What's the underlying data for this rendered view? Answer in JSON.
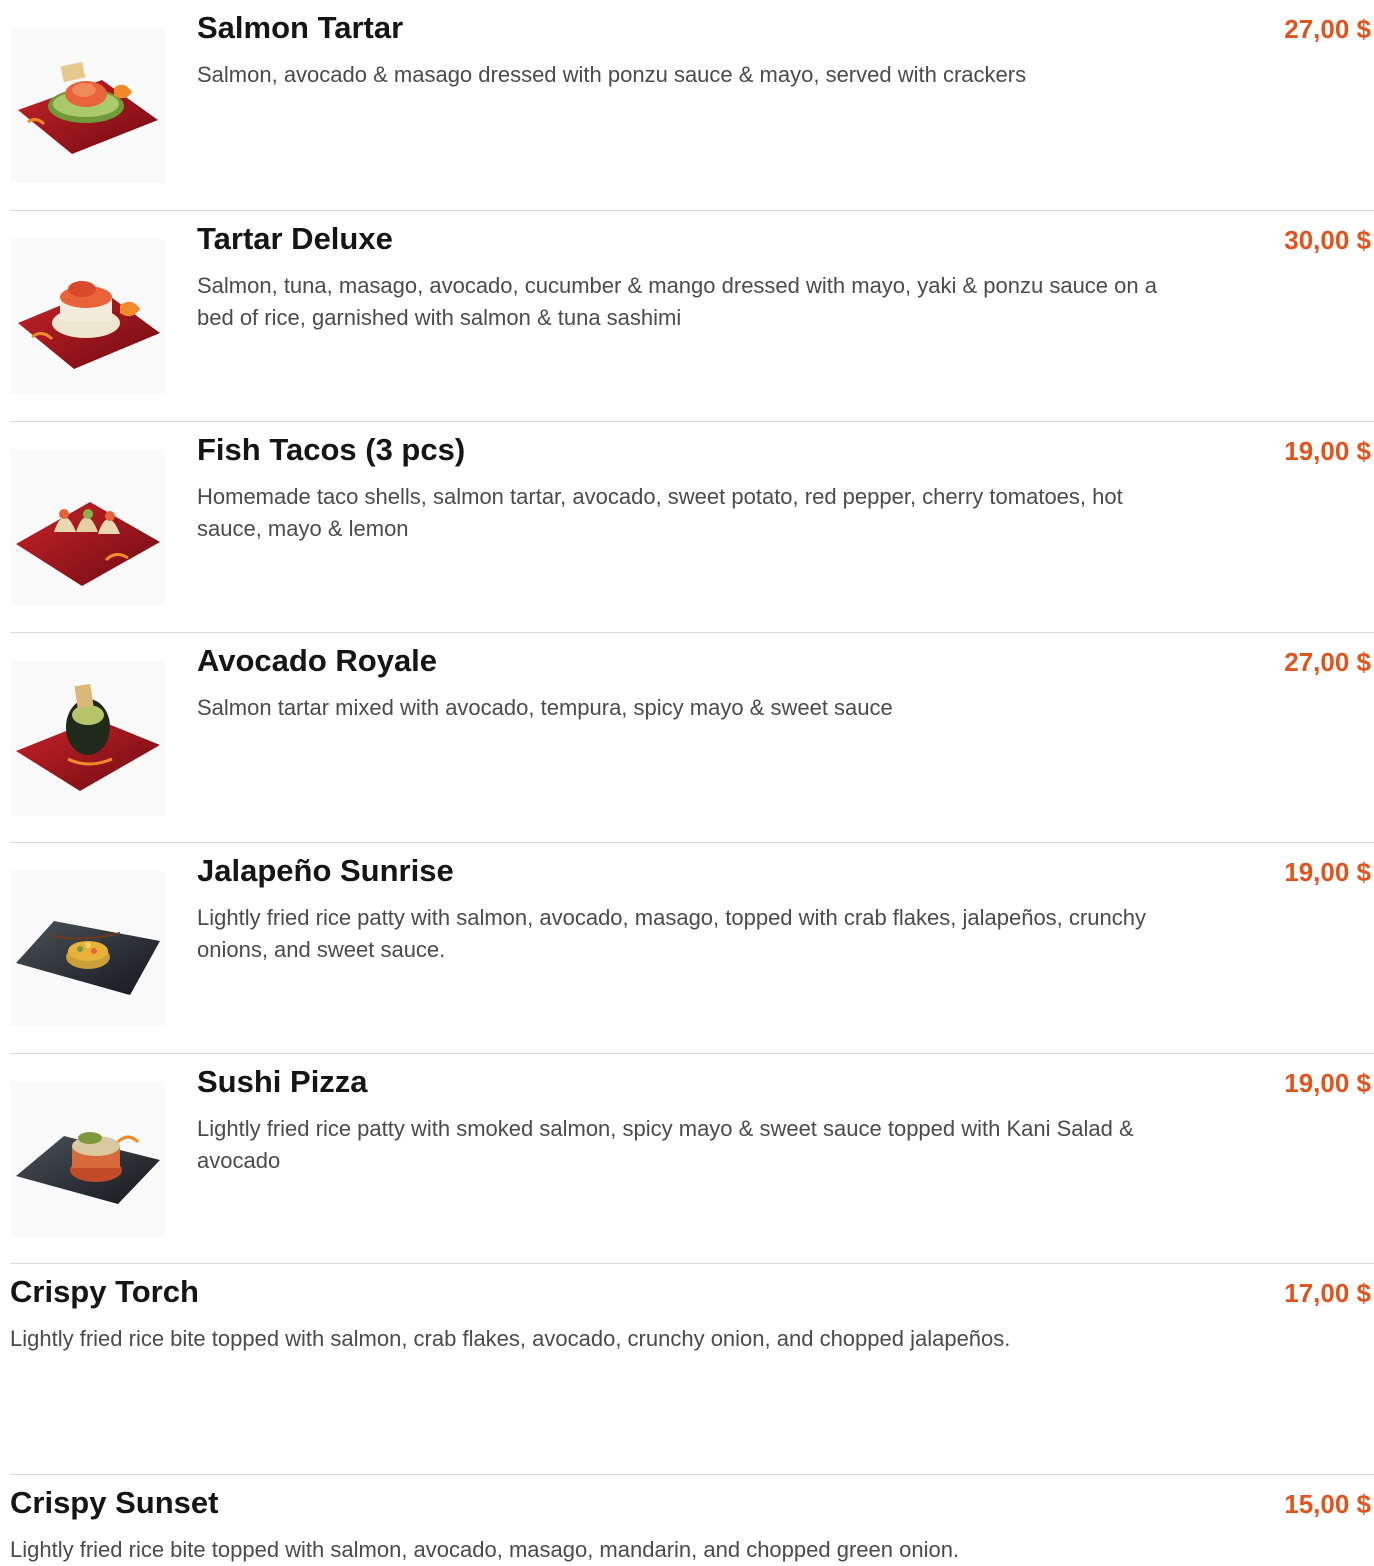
{
  "menu": {
    "items": [
      {
        "name": "Salmon Tartar",
        "description": "Salmon, avocado & masago dressed with ponzu sauce & mayo, served with crackers",
        "price": "27,00 $"
      },
      {
        "name": "Tartar Deluxe",
        "description": "Salmon, tuna, masago, avocado, cucumber & mango dressed with mayo, yaki & ponzu sauce on a bed of rice, garnished with salmon & tuna sashimi",
        "price": "30,00 $"
      },
      {
        "name": "Fish Tacos (3 pcs)",
        "description": "Homemade taco shells, salmon tartar, avocado, sweet potato, red pepper, cherry tomatoes, hot sauce, mayo & lemon",
        "price": "19,00 $"
      },
      {
        "name": "Avocado Royale",
        "description": "Salmon tartar mixed with avocado, tempura, spicy mayo & sweet sauce",
        "price": "27,00 $"
      },
      {
        "name": "Jalapeño Sunrise",
        "description": "Lightly fried rice patty with salmon, avocado, masago, topped with crab flakes, jalapeños, crunchy onions, and sweet sauce.",
        "price": "19,00 $"
      },
      {
        "name": "Sushi Pizza",
        "description": "Lightly fried rice patty with smoked salmon, spicy mayo & sweet sauce topped with Kani Salad & avocado",
        "price": "19,00 $"
      },
      {
        "name": "Crispy Torch",
        "description": "Lightly fried rice bite topped with salmon, crab flakes, avocado, crunchy onion, and chopped jalapeños.",
        "price": "17,00 $"
      },
      {
        "name": "Crispy Sunset",
        "description": "Lightly fried rice bite topped with salmon, avocado, masago, mandarin, and chopped green onion.",
        "price": "15,00 $"
      }
    ]
  },
  "colors": {
    "price": "#e2541e",
    "title": "#151515",
    "description": "#4b4b4b",
    "divider": "#dcdcdc",
    "plate_red": "#a3141a",
    "plate_dark": "#2b2f33"
  },
  "icons": {
    "thumbnail": "dish-photo"
  }
}
